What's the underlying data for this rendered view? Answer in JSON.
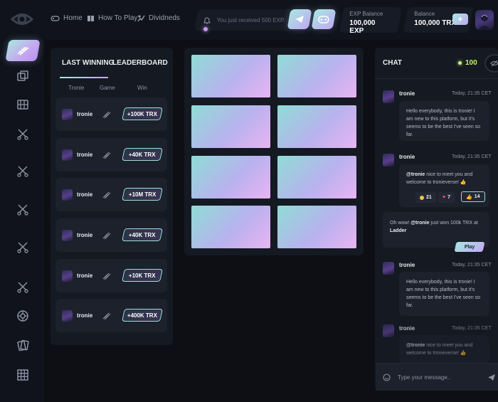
{
  "nav": {
    "home": "Home",
    "how_to_play": "How To Play",
    "dividends": "Dividneds"
  },
  "notification": {
    "text": "You just received 500 EXP."
  },
  "balances": {
    "exp_label": "EXP Balance",
    "exp_value": "100,000 EXP",
    "trx_label": "Balance",
    "trx_value": "100,000 TRX",
    "plus": "+"
  },
  "winners": {
    "tab_last": "LAST WINNING",
    "tab_leaderboard": "LEADERBOARD",
    "col_user": "Tronie",
    "col_game": "Game",
    "col_win": "Win",
    "rows": [
      {
        "name": "tronie",
        "win": "+100K TRX"
      },
      {
        "name": "tronie",
        "win": "+40K TRX"
      },
      {
        "name": "tronie",
        "win": "+10M TRX"
      },
      {
        "name": "tronie",
        "win": "+40K TRX"
      },
      {
        "name": "tronie",
        "win": "+10K TRX"
      },
      {
        "name": "tronie",
        "win": "+400K TRX"
      }
    ]
  },
  "chat": {
    "title": "CHAT",
    "online": "100",
    "messages": [
      {
        "name": "tronie",
        "time": "Today, 21:35 CET",
        "text": "Hello everybody, this is tronie! I am new to this platform, but it's seems to be the best I've seen so far."
      },
      {
        "name": "tronie",
        "time": "Today, 21:35 CET",
        "mention": "@tronie",
        "text": " nice to meet you and welcome to tronieverse! 👍"
      },
      {
        "name": "tronie",
        "time": "Today, 21:35 CET",
        "text": "Hello everybody, this is tronie! I am new to this platform, but it's seems to be the best I've seen so far."
      },
      {
        "name": "tronie",
        "time": "Today, 21:35 CET",
        "mention": "@tronie",
        "text": " nice to meet you and welcome to tronieverse! 👍"
      }
    ],
    "reactions": [
      "21",
      "7",
      "14"
    ],
    "system": {
      "lead": "Oh wow! ",
      "mention": "@tronie",
      "mid": " just won 100k TRX at",
      "game": "Ladder",
      "play": "Play"
    },
    "input_placeholder": "Type your message.."
  },
  "colors": {
    "accent_teal": "#a5e8e2",
    "accent_violet": "#c2a8f2",
    "online_green": "#c6f07a",
    "background": "#0d0f15"
  }
}
